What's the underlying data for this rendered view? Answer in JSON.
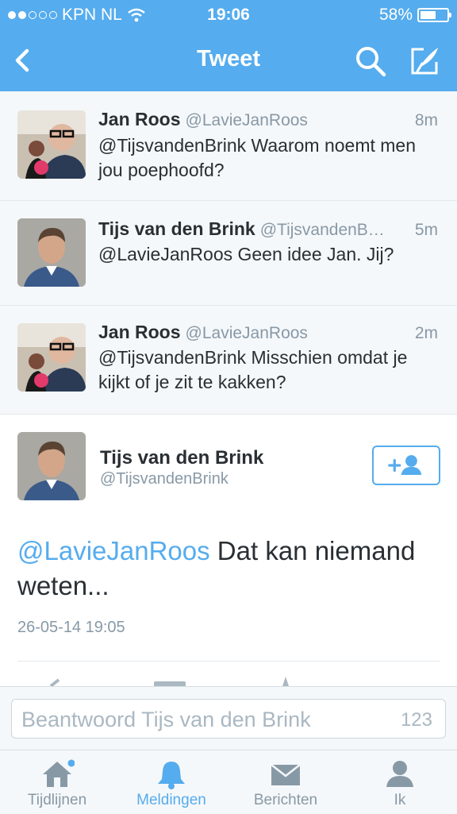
{
  "status": {
    "carrier": "KPN NL",
    "time": "19:06",
    "battery": "58%",
    "battery_level": 0.58
  },
  "nav": {
    "title": "Tweet"
  },
  "tweets": [
    {
      "name": "Jan Roos",
      "handle": "@LavieJanRoos",
      "time": "8m",
      "text": "@TijsvandenBrink Waarom noemt men jou poephoofd?"
    },
    {
      "name": "Tijs van den Brink",
      "handle": "@TijsvandenB…",
      "time": "5m",
      "text": "@LavieJanRoos Geen idee Jan. Jij?"
    },
    {
      "name": "Jan Roos",
      "handle": "@LavieJanRoos",
      "time": "2m",
      "text": "@TijsvandenBrink Misschien omdat je kijkt of je zit te kakken?"
    }
  ],
  "focus": {
    "name": "Tijs van den Brink",
    "handle": "@TijsvandenBrink",
    "mention": "@LavieJanRoos",
    "text": " Dat kan niemand weten...",
    "date": "26-05-14 19:05"
  },
  "reply": {
    "placeholder": "Beantwoord Tijs van den Brink",
    "count": "123"
  },
  "tabs": [
    {
      "label": "Tijdlijnen",
      "icon": "home-icon",
      "notify": true
    },
    {
      "label": "Meldingen",
      "icon": "bell-icon",
      "active": true
    },
    {
      "label": "Berichten",
      "icon": "envelope-icon"
    },
    {
      "label": "Ik",
      "icon": "person-icon"
    }
  ],
  "colors": {
    "accent": "#55acee",
    "text": "#292f33",
    "muted": "#8899a6",
    "background": "#f5f8fa"
  }
}
